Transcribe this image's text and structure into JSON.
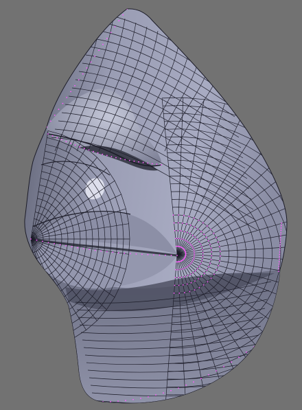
{
  "viewport": {
    "background": "#727272",
    "display_mode": "wireframe-on-shaded",
    "subject": "mesh-face-mouth-nose-region"
  },
  "mesh": {
    "face_color": "#9a9db4",
    "face_shadow": "#4e5062",
    "face_highlight": "#e4e6f2",
    "wire_color": "#1c1c28",
    "vertex_color": "#ff5cff",
    "vertex_display": "visible"
  }
}
